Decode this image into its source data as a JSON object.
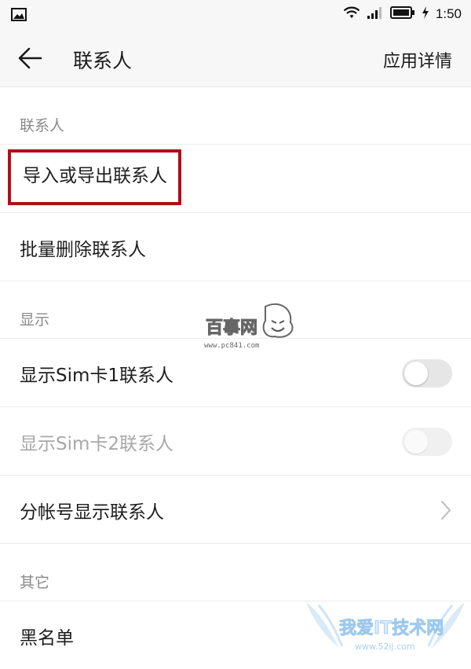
{
  "status_bar": {
    "time": "1:50",
    "icons": [
      "image-icon",
      "wifi-icon",
      "signal-icon",
      "battery-icon",
      "charging-icon"
    ]
  },
  "app_bar": {
    "back_icon": "arrow-left-icon",
    "title": "联系人",
    "action": "应用详情"
  },
  "sections": {
    "contacts_header": "联系人",
    "import_export": "导入或导出联系人",
    "batch_delete": "批量删除联系人",
    "display_header": "显示",
    "show_sim1": "显示Sim卡1联系人",
    "show_sim2": "显示Sim卡2联系人",
    "show_by_account": "分帐号显示联系人",
    "other_header": "其它",
    "blacklist": "黑名单"
  },
  "toggles": {
    "sim1_on": false,
    "sim2_on": false,
    "sim2_enabled": false
  },
  "highlight_color": "#b00f16",
  "watermarks": {
    "center_logo_text": "百事网",
    "center_url": "www.pc841.com",
    "corner_logo_text": "我爱IT技术网",
    "corner_url": "www.52ij.com"
  }
}
